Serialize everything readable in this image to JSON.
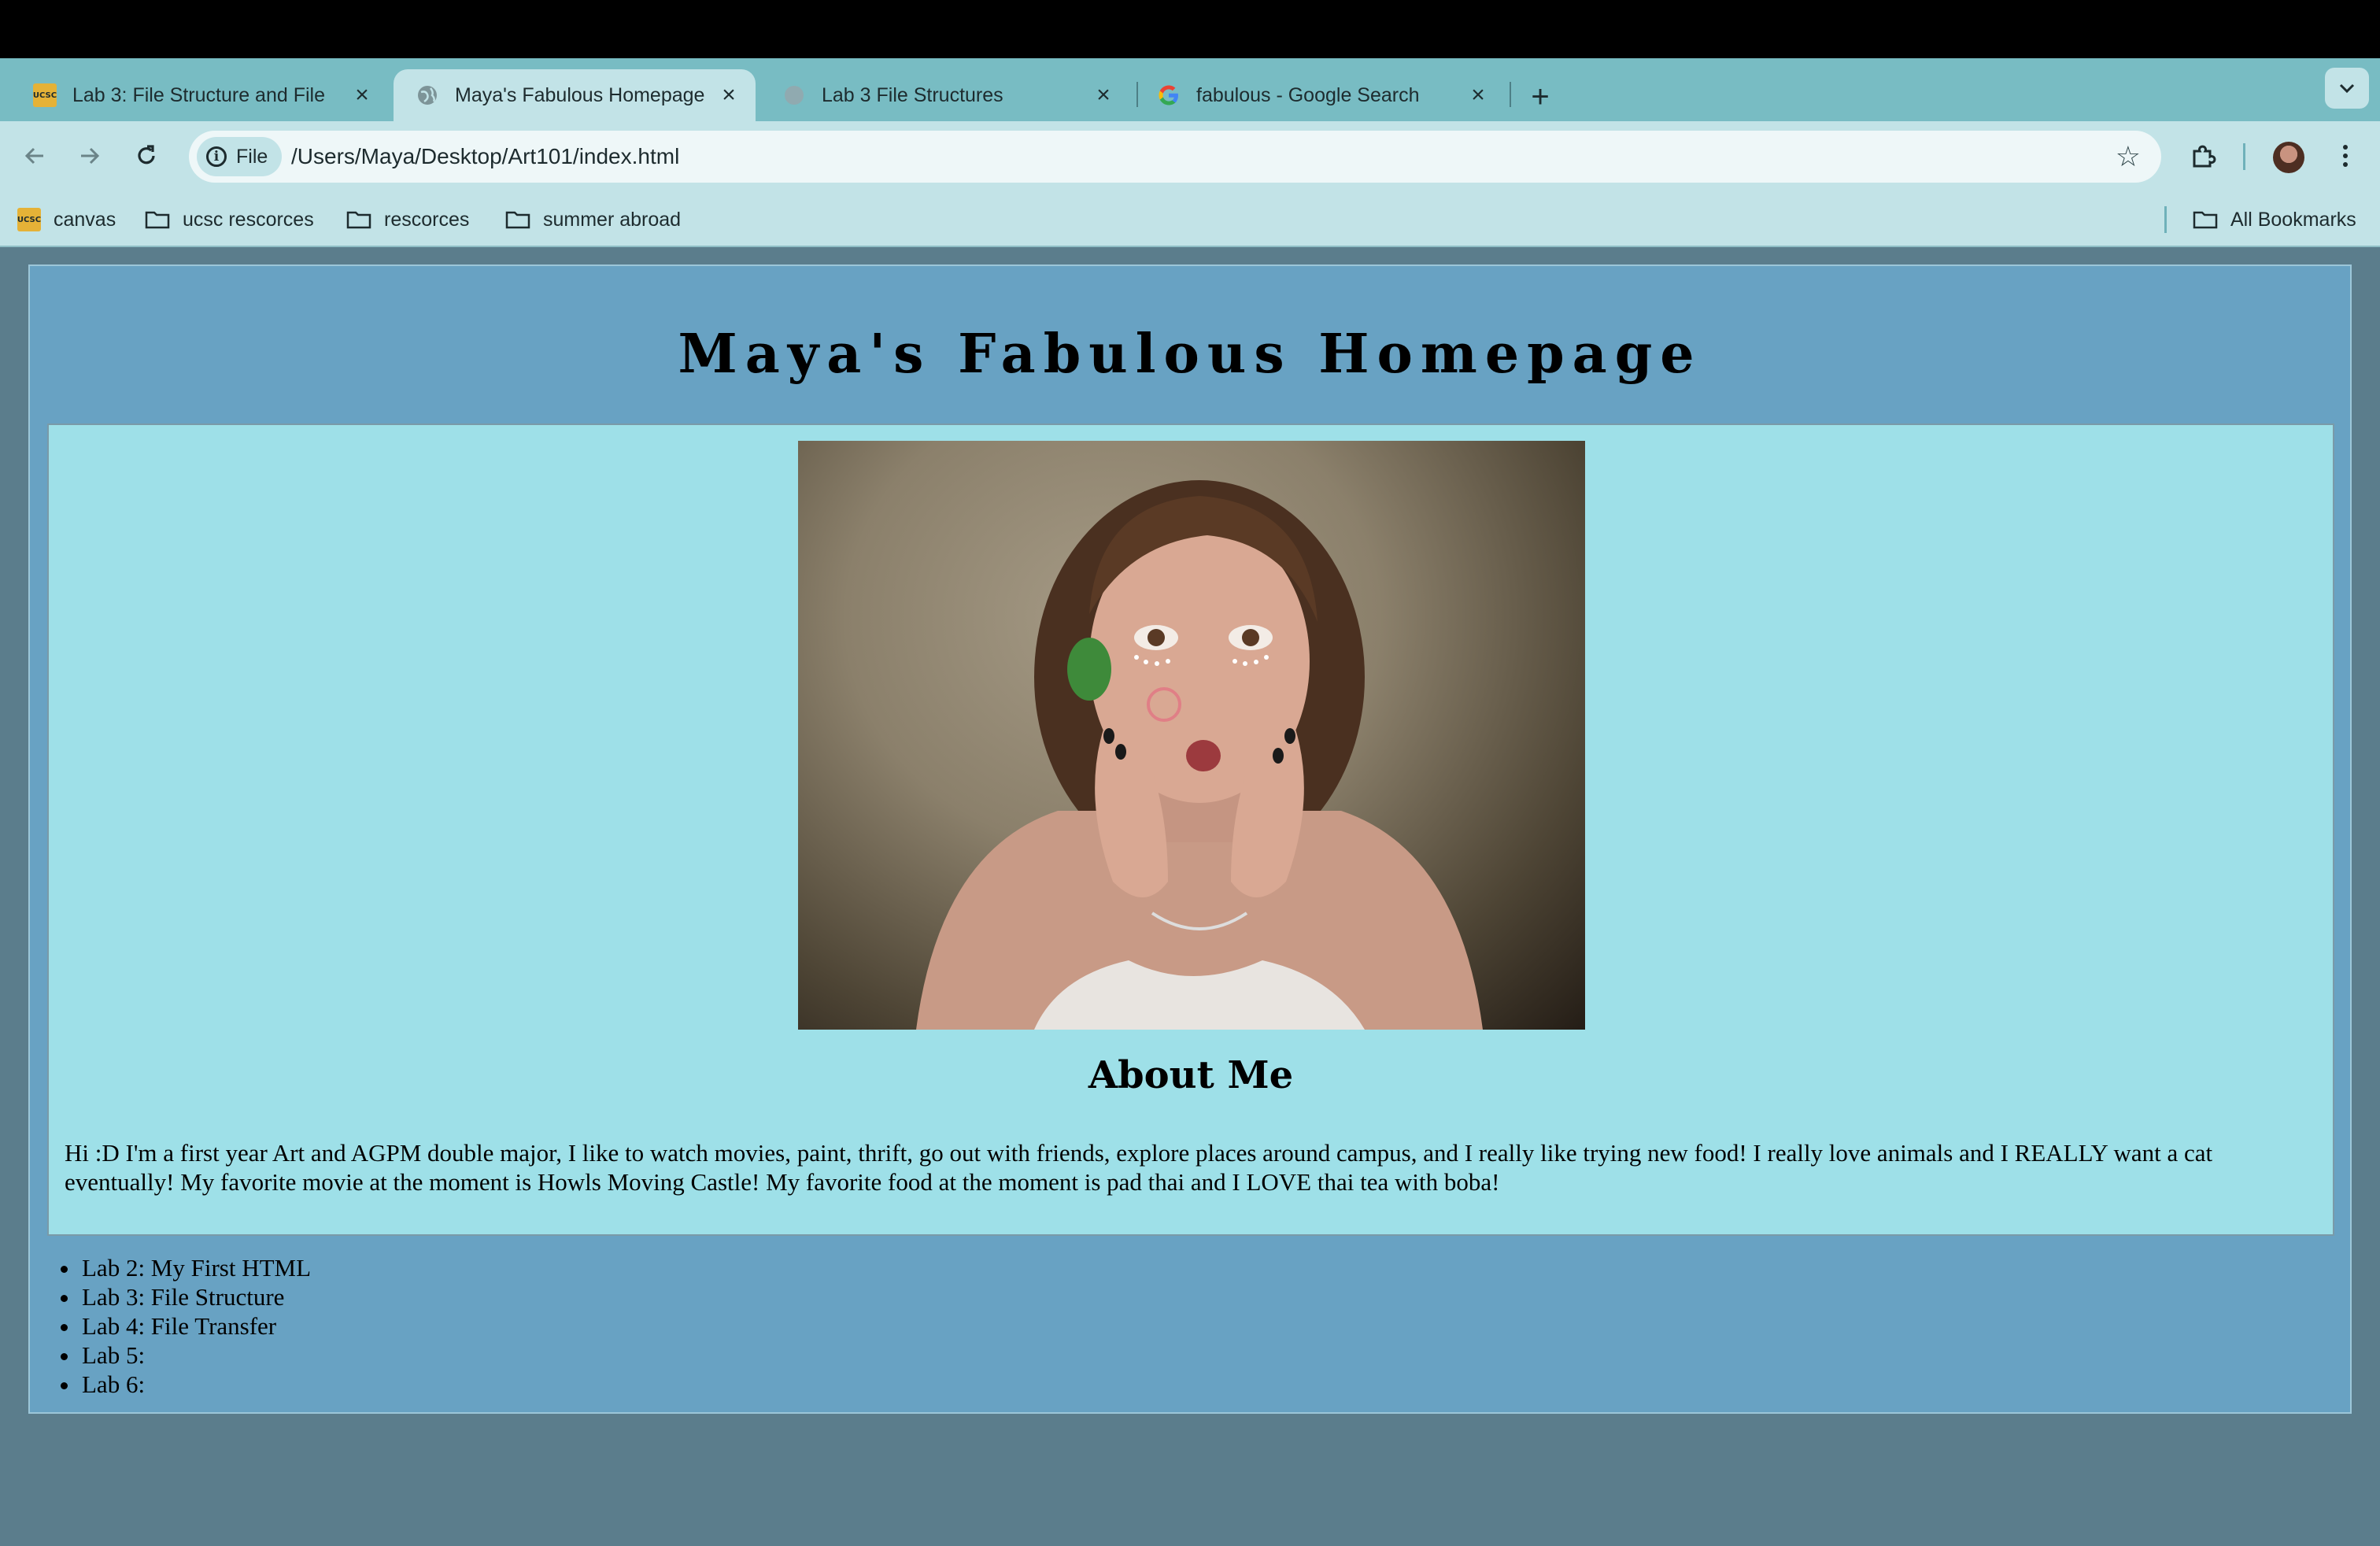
{
  "tabs": [
    {
      "title": "Lab 3: File Structure and File",
      "favicon": "ucsc-canvas-icon",
      "active": false
    },
    {
      "title": "Maya's Fabulous Homepage",
      "favicon": "globe-icon",
      "active": true
    },
    {
      "title": "Lab 3 File Structures",
      "favicon": "loading-globe-icon",
      "active": false
    },
    {
      "title": "fabulous - Google Search",
      "favicon": "google-icon",
      "active": false
    }
  ],
  "toolbar": {
    "chip_label": "File",
    "url": "/Users/Maya/Desktop/Art101/index.html"
  },
  "bookmarks": {
    "items": [
      "canvas",
      "ucsc rescorces",
      "rescorces",
      "summer abroad"
    ],
    "all_label": "All Bookmarks"
  },
  "page": {
    "title": "Maya's Fabulous Homepage",
    "about_heading": "About Me",
    "bio": "Hi :D I'm a first year Art and AGPM double major, I like to watch movies, paint, thrift, go out with friends, explore places around campus, and I really like trying new food! I really love animals and I REALLY want a cat eventually! My favorite movie at the moment is Howls Moving Castle! My favorite food at the moment is pad thai and I LOVE thai tea with boba!",
    "labs": [
      "Lab 2: My First HTML",
      "Lab 3: File Structure",
      "Lab 4: File Transfer",
      "Lab 5:",
      "Lab 6:"
    ]
  },
  "colors": {
    "tab_strip": "#78bcc3",
    "toolbar": "#c2e3e7",
    "page_bg": "#68a2c3",
    "about_bg": "#9ee0e8",
    "outer_bg": "#5b7d8c"
  }
}
